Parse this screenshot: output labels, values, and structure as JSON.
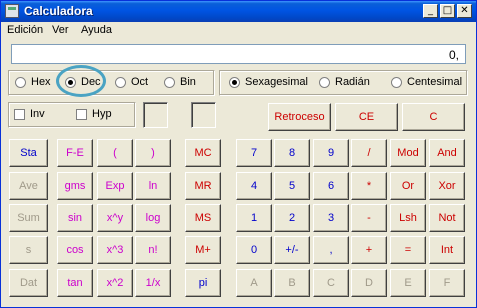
{
  "window": {
    "title": "Calculadora"
  },
  "menu": [
    {
      "label": "Edición"
    },
    {
      "label": "Ver"
    },
    {
      "label": "Ayuda"
    }
  ],
  "display": {
    "value": "0,"
  },
  "base_group": [
    {
      "label": "Hex",
      "checked": false
    },
    {
      "label": "Dec",
      "checked": true
    },
    {
      "label": "Oct",
      "checked": false
    },
    {
      "label": "Bin",
      "checked": false
    }
  ],
  "angle_group": [
    {
      "label": "Sexagesimal",
      "checked": true
    },
    {
      "label": "Radián",
      "checked": false
    },
    {
      "label": "Centesimal",
      "checked": false
    }
  ],
  "checkboxes": [
    {
      "label": "Inv"
    },
    {
      "label": "Hyp"
    }
  ],
  "top_buttons": [
    {
      "label": "Retroceso"
    },
    {
      "label": "CE"
    },
    {
      "label": "C"
    }
  ],
  "colors": {
    "blue": "#0000cc",
    "red": "#cc0000",
    "magenta": "#cc00cc",
    "gray": "#a09a8a"
  },
  "grid": [
    [
      "Sta",
      "F-E",
      "(",
      ")",
      "MC",
      "7",
      "8",
      "9",
      "/",
      "Mod",
      "And"
    ],
    [
      "Ave",
      "gms",
      "Exp",
      "ln",
      "MR",
      "4",
      "5",
      "6",
      "*",
      "Or",
      "Xor"
    ],
    [
      "Sum",
      "sin",
      "x^y",
      "log",
      "MS",
      "1",
      "2",
      "3",
      "-",
      "Lsh",
      "Not"
    ],
    [
      "s",
      "cos",
      "x^3",
      "n!",
      "M+",
      "0",
      "+/-",
      ",",
      "+",
      "=",
      "Int"
    ],
    [
      "Dat",
      "tan",
      "x^2",
      "1/x",
      "pi",
      "A",
      "B",
      "C",
      "D",
      "E",
      "F"
    ]
  ],
  "grid_colors": [
    [
      "blue",
      "magenta",
      "magenta",
      "magenta",
      "red",
      "blue",
      "blue",
      "blue",
      "red",
      "red",
      "red"
    ],
    [
      "gray",
      "magenta",
      "magenta",
      "magenta",
      "red",
      "blue",
      "blue",
      "blue",
      "red",
      "red",
      "red"
    ],
    [
      "gray",
      "magenta",
      "magenta",
      "magenta",
      "red",
      "blue",
      "blue",
      "blue",
      "red",
      "red",
      "red"
    ],
    [
      "gray",
      "magenta",
      "magenta",
      "magenta",
      "red",
      "blue",
      "blue",
      "blue",
      "red",
      "red",
      "red"
    ],
    [
      "gray",
      "magenta",
      "magenta",
      "magenta",
      "blue",
      "gray",
      "gray",
      "gray",
      "gray",
      "gray",
      "gray"
    ]
  ]
}
